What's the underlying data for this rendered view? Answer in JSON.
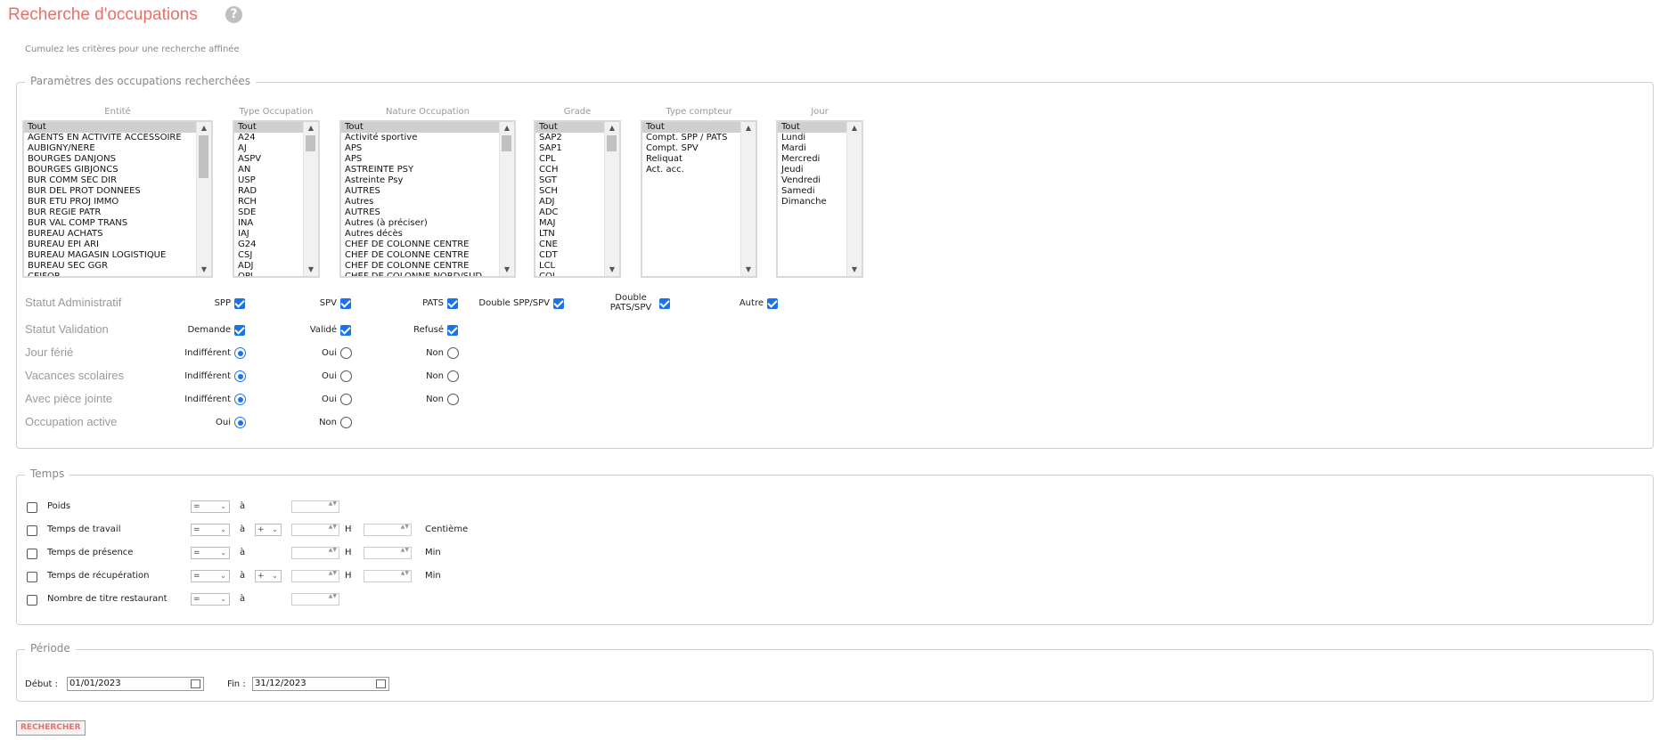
{
  "page": {
    "title": "Recherche d'occupations",
    "help_symbol": "?",
    "subtitle": "Cumulez les critères pour une recherche affinée"
  },
  "params": {
    "legend": "Paramètres des occupations recherchées",
    "lists": [
      {
        "label": "Entité",
        "items": [
          "Tout",
          "AGENTS EN ACTIVITE ACCESSOIRE",
          "AUBIGNY/NERE",
          "BOURGES DANJONS",
          "BOURGES GIBJONCS",
          "BUR COMM SEC DIR",
          "BUR DEL PROT DONNEES",
          "BUR ETU PROJ IMMO",
          "BUR REGIE PATR",
          "BUR VAL COMP TRANS",
          "BUREAU ACHATS",
          "BUREAU EPI ARI",
          "BUREAU MAGASIN LOGISTIQUE",
          "BUREAU SEC GGR",
          "CEIFOR"
        ]
      },
      {
        "label": "Type Occupation",
        "items": [
          "Tout",
          "A24",
          "AJ",
          "ASPV",
          "AN",
          "USP",
          "RAD",
          "RCH",
          "SDE",
          "INA",
          "IAJ",
          "G24",
          "CSJ",
          "ADJ",
          "OPJ"
        ]
      },
      {
        "label": "Nature Occupation",
        "items": [
          "Tout",
          "Activité sportive",
          "APS",
          "APS",
          "ASTREINTE PSY",
          "Astreinte Psy",
          "AUTRES",
          "Autres",
          "AUTRES",
          "Autres (à préciser)",
          "Autres décès",
          "CHEF DE COLONNE CENTRE",
          "CHEF DE COLONNE CENTRE",
          "CHEF DE COLONNE CENTRE",
          "CHEF DE COLONNE NORD/SUD"
        ]
      },
      {
        "label": "Grade",
        "items": [
          "Tout",
          "SAP2",
          "SAP1",
          "CPL",
          "CCH",
          "SGT",
          "SCH",
          "ADJ",
          "ADC",
          "MAJ",
          "LTN",
          "CNE",
          "CDT",
          "LCL",
          "COL"
        ]
      },
      {
        "label": "Type compteur",
        "items": [
          "Tout",
          "Compt. SPP / PATS",
          "Compt. SPV",
          "Reliquat",
          "Act. acc."
        ]
      },
      {
        "label": "Jour",
        "items": [
          "Tout",
          "Lundi",
          "Mardi",
          "Mercredi",
          "Jeudi",
          "Vendredi",
          "Samedi",
          "Dimanche"
        ]
      }
    ],
    "statut_admin": {
      "label": "Statut Administratif",
      "options": [
        {
          "label": "SPP",
          "checked": true
        },
        {
          "label": "SPV",
          "checked": true
        },
        {
          "label": "PATS",
          "checked": true
        },
        {
          "label": "Double SPP/SPV",
          "checked": true
        },
        {
          "label": "Double PATS/SPV",
          "checked": true
        },
        {
          "label": "Autre",
          "checked": true
        }
      ]
    },
    "statut_validation": {
      "label": "Statut Validation",
      "options": [
        {
          "label": "Demande",
          "checked": true
        },
        {
          "label": "Validé",
          "checked": true
        },
        {
          "label": "Refusé",
          "checked": true
        }
      ]
    },
    "radios": [
      {
        "label": "Jour férié",
        "options": [
          "Indifférent",
          "Oui",
          "Non"
        ],
        "selected": 0
      },
      {
        "label": "Vacances scolaires",
        "options": [
          "Indifférent",
          "Oui",
          "Non"
        ],
        "selected": 0
      },
      {
        "label": "Avec pièce jointe",
        "options": [
          "Indifférent",
          "Oui",
          "Non"
        ],
        "selected": 0
      },
      {
        "label": "Occupation active",
        "options": [
          "Oui",
          "Non"
        ],
        "selected": 0
      }
    ]
  },
  "temps": {
    "legend": "Temps",
    "a_label": "à",
    "h_label": "H",
    "op_value": "=",
    "sign_value": "+",
    "rows": [
      {
        "label": "Poids",
        "sign": false,
        "hours": false,
        "unit": ""
      },
      {
        "label": "Temps de travail",
        "sign": true,
        "hours": true,
        "unit": "Centième"
      },
      {
        "label": "Temps de présence",
        "sign": false,
        "hours": true,
        "unit": "Min"
      },
      {
        "label": "Temps de récupération",
        "sign": true,
        "hours": true,
        "unit": "Min"
      },
      {
        "label": "Nombre de titre restaurant",
        "sign": false,
        "hours": false,
        "unit": ""
      }
    ]
  },
  "periode": {
    "legend": "Période",
    "debut_label": "Début :",
    "debut_value": "01/01/2023",
    "fin_label": "Fin :",
    "fin_value": "31/12/2023"
  },
  "actions": {
    "search_label": "RECHERCHER"
  },
  "colors": {
    "accent": "#e8706a",
    "check": "#1a73e8"
  }
}
